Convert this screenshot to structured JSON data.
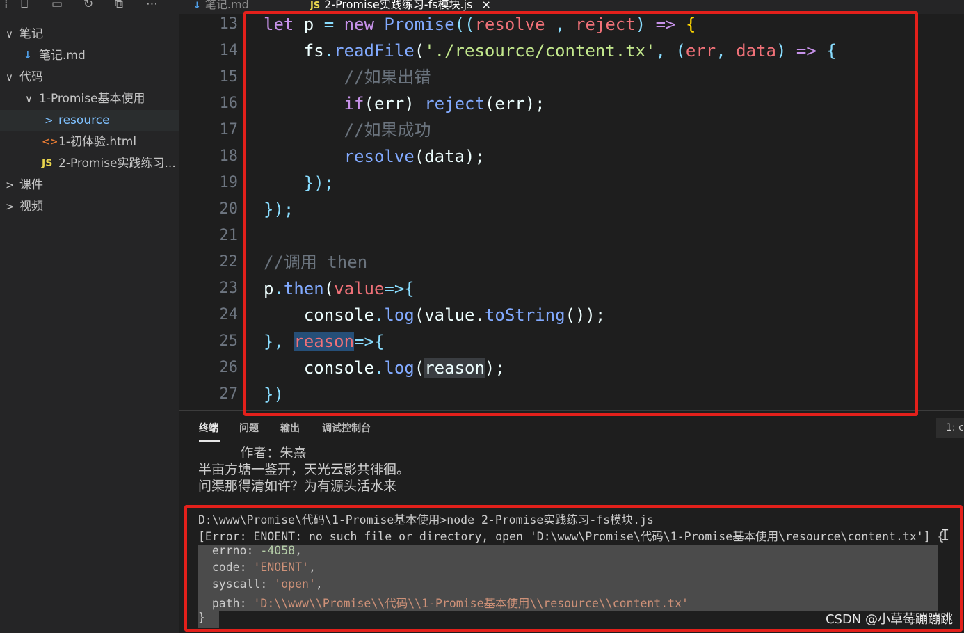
{
  "toolbar": {
    "icons": [
      "new-file-icon",
      "new-folder-icon",
      "refresh-icon",
      "collapse-all-icon",
      "more-icon"
    ],
    "glyphs": [
      "⎕",
      "▭",
      "↻",
      "⧉",
      "⋯"
    ]
  },
  "explorer": {
    "rows": [
      {
        "label": "笔记",
        "chev": "∨"
      },
      {
        "label": "笔记.md",
        "icon": "↓"
      },
      {
        "label": "代码",
        "chev": "∨"
      },
      {
        "label": "1-Promise基本使用",
        "chev": "∨"
      },
      {
        "label": "resource",
        "chev": ">"
      },
      {
        "label": "1-初体验.html",
        "icon": "<>"
      },
      {
        "label": "2-Promise实践练习...",
        "icon": "JS"
      },
      {
        "label": "课件",
        "chev": ">"
      },
      {
        "label": "视频",
        "chev": ">"
      }
    ]
  },
  "tabs": [
    {
      "label": "笔记.md",
      "icon": "↓"
    },
    {
      "label": "2-Promise实践练习-fs模块.js",
      "icon": "JS",
      "close": "×"
    }
  ],
  "editor": {
    "line_numbers": [
      "13",
      "14",
      "15",
      "16",
      "17",
      "18",
      "19",
      "20",
      "21",
      "22",
      "23",
      "24",
      "25",
      "26",
      "27"
    ],
    "lines": [
      [
        [
          "let ",
          "kw"
        ],
        [
          "p ",
          "id"
        ],
        [
          "= ",
          "op"
        ],
        [
          "new ",
          "kw"
        ],
        [
          "Promise",
          "fn"
        ],
        [
          "((",
          "br2"
        ],
        [
          "resolve",
          "par"
        ],
        [
          " , ",
          "pun"
        ],
        [
          "reject",
          "par"
        ],
        [
          ") ",
          "br2"
        ],
        [
          "=> ",
          "kw"
        ],
        [
          "{",
          "br"
        ]
      ],
      [
        [
          "    fs",
          "plain"
        ],
        [
          ".",
          "pun"
        ],
        [
          "readFile",
          "fn"
        ],
        [
          "(",
          "plain"
        ],
        [
          "'./resource/content.tx'",
          "str"
        ],
        [
          ", ",
          "pun"
        ],
        [
          "(",
          "op"
        ],
        [
          "err",
          "par"
        ],
        [
          ", ",
          "pun"
        ],
        [
          "data",
          "par"
        ],
        [
          ") ",
          "op"
        ],
        [
          "=> ",
          "kw"
        ],
        [
          "{",
          "op"
        ]
      ],
      [
        [
          "        //如果出错",
          "cm"
        ]
      ],
      [
        [
          "        ",
          "plain"
        ],
        [
          "if",
          "kw"
        ],
        [
          "(err) ",
          "plain"
        ],
        [
          "reject",
          "fn"
        ],
        [
          "(err);",
          "plain"
        ]
      ],
      [
        [
          "        //如果成功",
          "cm"
        ]
      ],
      [
        [
          "        ",
          "plain"
        ],
        [
          "resolve",
          "fn"
        ],
        [
          "(data);",
          "plain"
        ]
      ],
      [
        [
          "    });",
          "op"
        ]
      ],
      [
        [
          "});",
          "op"
        ]
      ],
      [
        [
          "",
          "plain"
        ]
      ],
      [
        [
          "//调用 then",
          "cm"
        ]
      ],
      [
        [
          "p",
          "plain"
        ],
        [
          ".",
          "pun"
        ],
        [
          "then",
          "fn"
        ],
        [
          "(",
          "plain"
        ],
        [
          "value",
          "par"
        ],
        [
          "=>{",
          "op"
        ]
      ],
      [
        [
          "    console",
          "plain"
        ],
        [
          ".",
          "pun"
        ],
        [
          "log",
          "fn"
        ],
        [
          "(value.",
          "plain"
        ],
        [
          "toString",
          "fn"
        ],
        [
          "());",
          "plain"
        ]
      ],
      [
        [
          "}, ",
          "op"
        ],
        [
          "reason",
          "par-sel"
        ],
        [
          "=>{",
          "op"
        ]
      ],
      [
        [
          "    console",
          "plain"
        ],
        [
          ".",
          "pun"
        ],
        [
          "log",
          "fn"
        ],
        [
          "(",
          "plain"
        ],
        [
          "reason",
          "plain-word"
        ],
        [
          ");",
          "plain"
        ]
      ],
      [
        [
          "})",
          "op"
        ]
      ]
    ]
  },
  "panel": {
    "tabs": [
      "终端",
      "问题",
      "输出",
      "调试控制台"
    ],
    "right_label": "1: c",
    "poem": [
      "          作者：朱熹",
      "半亩方塘一鉴开，天光云影共徘徊。",
      "问渠那得清如许？为有源头活水来"
    ],
    "command": "D:\\www\\Promise\\代码\\1-Promise基本使用>node 2-Promise实践练习-fs模块.js",
    "error_line": "[Error: ENOENT: no such file or directory, open 'D:\\www\\Promise\\代码\\1-Promise基本使用\\resource\\content.tx'] {",
    "errno_key": "  errno: ",
    "errno_val": "-4058",
    "errno_end": ",",
    "code_key": "  code: ",
    "code_val": "'ENOENT'",
    "code_end": ",",
    "syscall_key": "  syscall: ",
    "syscall_val": "'open'",
    "syscall_end": ",",
    "path_key": "  path: ",
    "path_val": "'D:\\\\www\\\\Promise\\\\代码\\\\1-Promise基本使用\\\\resource\\\\content.tx'",
    "close_brace": "}"
  },
  "watermark": "CSDN @小草莓蹦蹦跳",
  "colors": {
    "annotation": "#e3201b",
    "accent": "#007acc"
  }
}
